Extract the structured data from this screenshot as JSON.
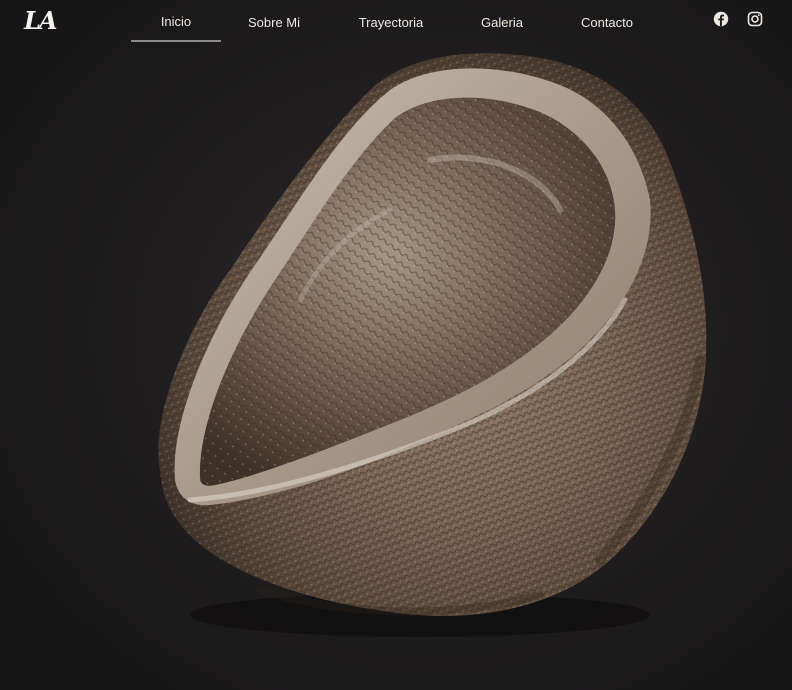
{
  "brand": {
    "logo_text": "LA"
  },
  "nav": {
    "items": [
      {
        "label": "Inicio",
        "active": true
      },
      {
        "label": "Sobre Mi",
        "active": false
      },
      {
        "label": "Trayectoria",
        "active": false
      },
      {
        "label": "Galeria",
        "active": false
      },
      {
        "label": "Contacto",
        "active": false
      }
    ]
  },
  "social": {
    "icons": [
      "facebook-icon",
      "instagram-icon"
    ]
  },
  "colors": {
    "background": "#1b1a1b",
    "nav_text": "#ede8e2",
    "active_underline": "#8c8a88"
  }
}
